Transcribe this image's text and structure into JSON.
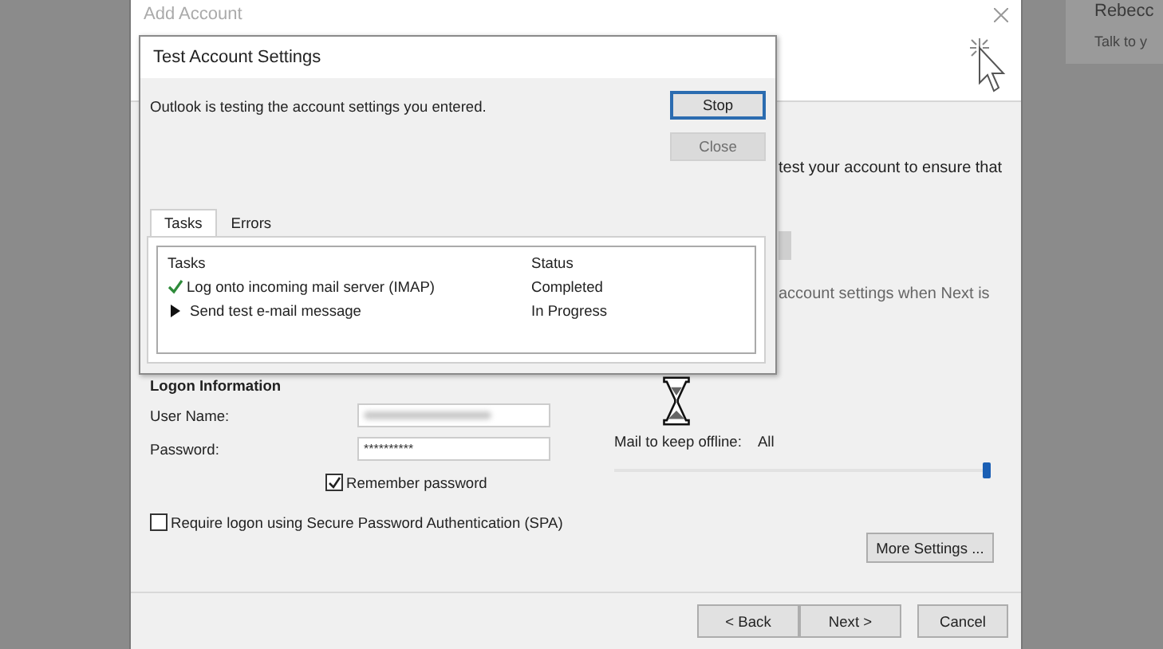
{
  "background_panel": {
    "title": "Rebecc",
    "subtitle": "Talk to y"
  },
  "add_account": {
    "title": "Add Account",
    "text_1": "test your account to ensure that",
    "text_2": "account settings when Next is",
    "logon_information": {
      "heading": "Logon Information",
      "user_name_label": "User Name:",
      "password_label": "Password:",
      "password_value": "**********",
      "remember_password": {
        "label": "Remember password",
        "checked": true
      },
      "require_spa": {
        "label": "Require logon using Secure Password Authentication (SPA)",
        "checked": false
      }
    },
    "mail_to_keep_offline": {
      "label": "Mail to keep offline:",
      "value": "All",
      "level": 1
    },
    "more_settings": "More Settings ...",
    "buttons": [
      {
        "label": "< Back"
      },
      {
        "label": "Next >"
      },
      {
        "label": "Cancel"
      }
    ]
  },
  "test_dialog": {
    "title": "Test Account Settings",
    "message": "Outlook is testing the account settings you entered.",
    "buttons": [
      {
        "label": "Stop",
        "disabled": false
      },
      {
        "label": "Close",
        "disabled": true
      }
    ],
    "tabs": [
      {
        "label": "Tasks",
        "selected": true
      },
      {
        "label": "Errors",
        "selected": false
      }
    ],
    "columns": [
      "Tasks",
      "Status"
    ],
    "tasks": [
      {
        "name": "Log onto incoming mail server (IMAP)",
        "status": "Completed",
        "kind": "completed"
      },
      {
        "name": "Send test e-mail message",
        "status": "In Progress",
        "kind": "in_progress"
      }
    ]
  }
}
